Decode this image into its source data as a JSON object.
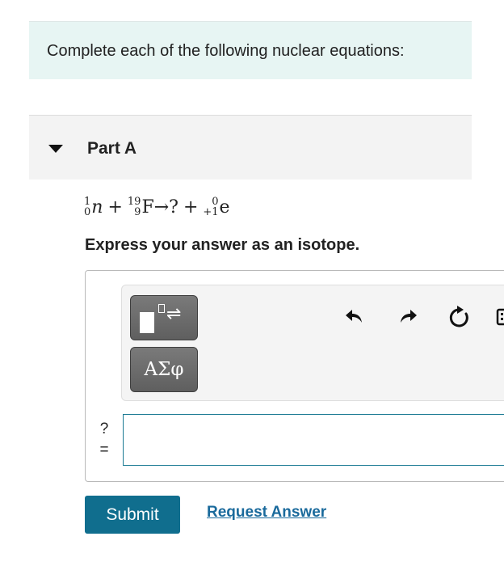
{
  "intro": {
    "text": "Complete each of the following nuclear equations:"
  },
  "part": {
    "title": "Part A",
    "expanded": true
  },
  "equation": {
    "term1": {
      "mass": "1",
      "atomic": "0",
      "symbol": "n"
    },
    "plus1": "+",
    "term2": {
      "mass": "19",
      "atomic": "9",
      "symbol": "F"
    },
    "arrow": "→",
    "unknown": "?",
    "plus2": "+",
    "term3": {
      "mass": "0",
      "atomic": "+1",
      "symbol": "e"
    }
  },
  "instruction": "Express your answer as an isotope.",
  "toolbar": {
    "template_icon": "isotope-template-icon",
    "greek_button_label": "ΑΣφ",
    "undo_icon": "undo-icon",
    "redo_icon": "redo-icon",
    "reset_icon": "reset-icon",
    "keyboard_icon": "keyboard-icon"
  },
  "answer": {
    "label_top": "?",
    "label_bottom": "=",
    "value": ""
  },
  "buttons": {
    "submit": "Submit",
    "request_answer": "Request Answer"
  },
  "colors": {
    "intro_bg": "#e7f5f3",
    "submit_bg": "#106e8e",
    "link": "#1a6a9c",
    "input_border": "#1a7a93"
  }
}
